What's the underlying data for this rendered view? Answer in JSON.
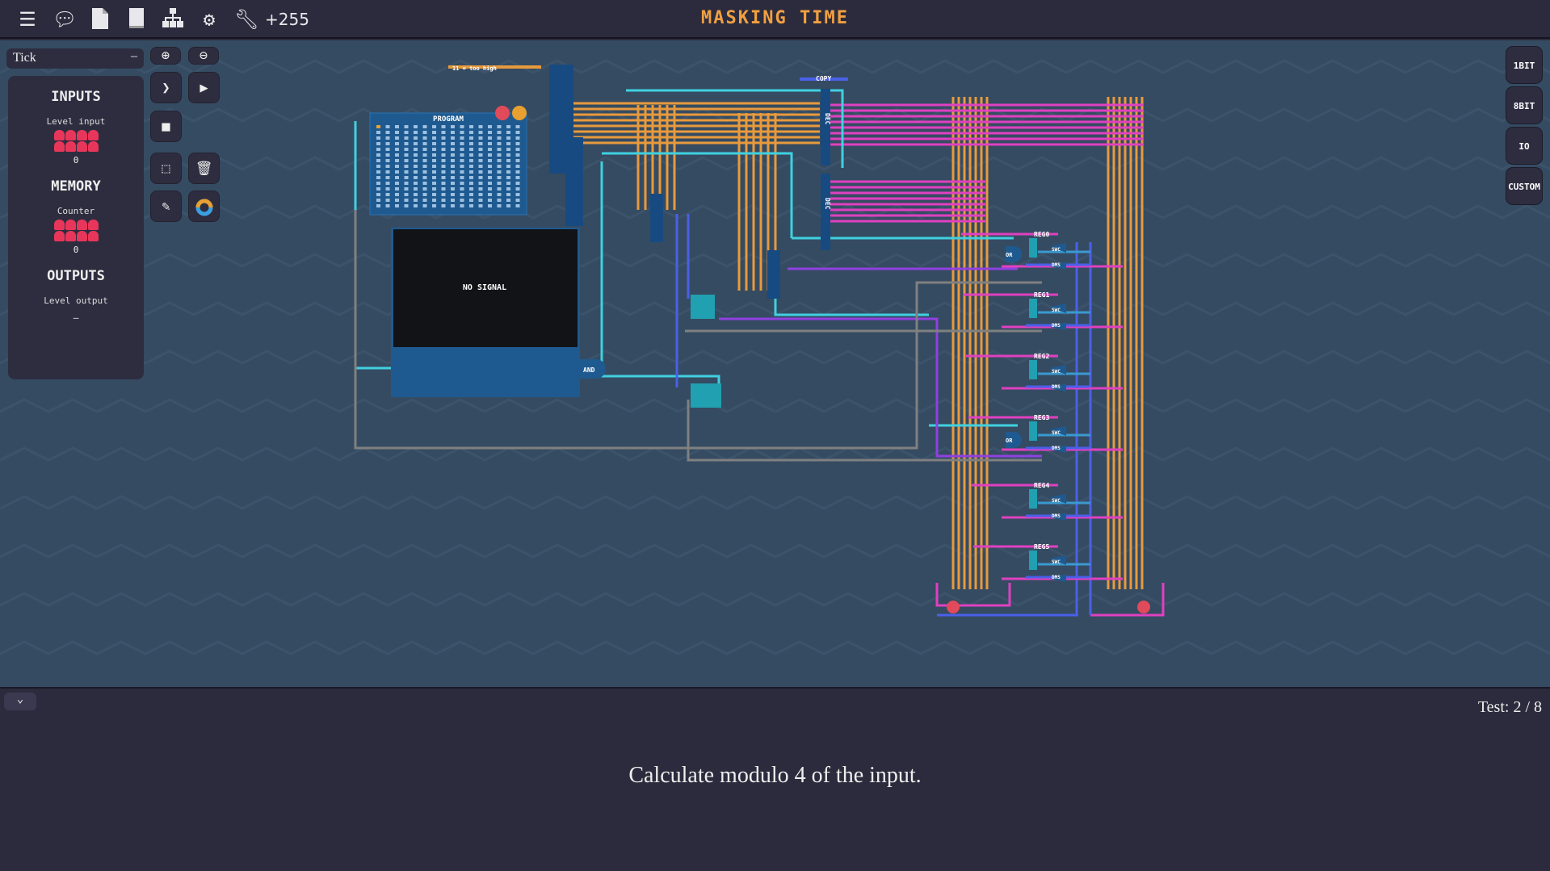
{
  "topbar": {
    "title": "MASKING TIME",
    "score": "+255",
    "icons": [
      "menu-icon",
      "chat-icon",
      "file-icon",
      "book-icon",
      "hierarchy-icon",
      "gear-icon",
      "wrench-icon"
    ]
  },
  "sidebar": {
    "tick_label": "Tick",
    "tick_toggle": "–",
    "inputs": {
      "heading": "INPUTS",
      "label": "Level input",
      "value": "0"
    },
    "memory": {
      "heading": "MEMORY",
      "label": "Counter",
      "value": "0"
    },
    "outputs": {
      "heading": "OUTPUTS",
      "label": "Level output",
      "value": "–"
    }
  },
  "tools": [
    "zoom-in",
    "zoom-out",
    "step",
    "play",
    "stop",
    "select",
    "delete",
    "pencil",
    "color"
  ],
  "component_tabs": [
    "1BIT",
    "8BIT",
    "IO",
    "CUSTOM"
  ],
  "circuit": {
    "program_label": "PROGRAM",
    "screen_text": "NO SIGNAL",
    "note": "11 = too high",
    "copy": "COPY",
    "and": "AND",
    "or": "OR",
    "dec": "DEC",
    "registers": [
      "REG0",
      "REG1",
      "REG2",
      "REG3",
      "REG4",
      "REG5"
    ],
    "swc": "SWC",
    "dms": "DMS"
  },
  "colors": {
    "accent": "#f0a040",
    "wire_orange": "#e89a3c",
    "wire_magenta": "#e040c0",
    "wire_cyan": "#40d0e0",
    "wire_purple": "#9040e0",
    "wire_blue": "#4a60e8",
    "wire_gray": "#808080",
    "led": "#e8365a"
  },
  "bottom": {
    "test": "Test: 2 / 8",
    "description": "Calculate modulo 4 of the input."
  }
}
